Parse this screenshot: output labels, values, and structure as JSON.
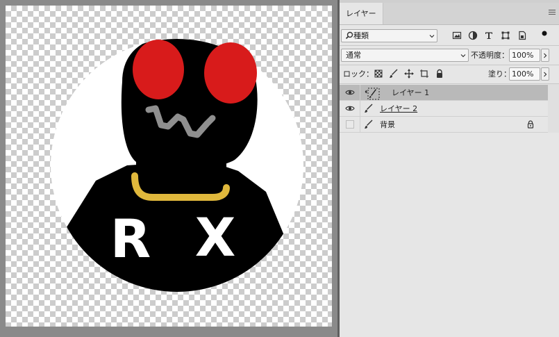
{
  "canvas": {
    "label_r": "R",
    "label_x": "X",
    "colors": {
      "eyes": "#d81b1b",
      "mouth": "#8f8f8f",
      "collar": "#e0b83c",
      "body": "#000000",
      "letters": "#ffffff"
    }
  },
  "panel": {
    "tab_label": "レイヤー",
    "filter": {
      "value": "種類"
    },
    "blend_mode": "通常",
    "opacity_label": "不透明度：",
    "opacity_value": "100%",
    "lock_label": "ロック：",
    "fill_label": "塗り：",
    "fill_value": "100%",
    "layers": [
      {
        "name": "レイヤー 1",
        "selected": true,
        "visible": true
      },
      {
        "name": "レイヤー 2",
        "selected": false,
        "visible": true,
        "underlined": true
      },
      {
        "name": "背景",
        "selected": false,
        "visible": false,
        "locked": true
      }
    ]
  }
}
